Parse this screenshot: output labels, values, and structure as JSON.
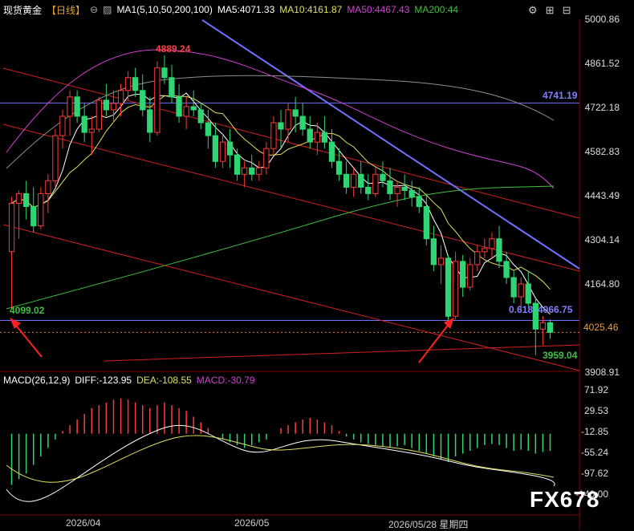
{
  "header": {
    "symbol": "现货黄金",
    "period": "【日线】",
    "ma_set": "MA1(5,10,50,200,100)",
    "ma5": "MA5:4071.33",
    "ma10": "MA10:4161.87",
    "ma50": "MA50:4467.43",
    "ma200": "MA200:44"
  },
  "macd_header": {
    "title": "MACD(26,12,9)",
    "diff": "DIFF:-123.95",
    "dea": "DEA:-108.55",
    "macd": "MACD:-30.79"
  },
  "price_axis": [
    "5000.86",
    "4861.52",
    "4722.18",
    "4582.83",
    "4443.49",
    "4304.14",
    "4164.80",
    "4025.46",
    "3908.91"
  ],
  "macd_axis": [
    "71.92",
    "29.53",
    "-12.85",
    "-55.24",
    "-97.62",
    "-140.00"
  ],
  "dates": [
    "2026/04",
    "2026/05",
    "2026/05/28 星期四"
  ],
  "annotations": {
    "high": "4889.24",
    "level1": "4741.19",
    "low1": "4099.02",
    "fib": "0.618",
    "fib_value": "4066.75",
    "low2": "3959.04"
  },
  "watermark": "FX678",
  "colors": {
    "up": "#ff3a3a",
    "down": "#2ed573",
    "ma5": "#ffffff",
    "ma10": "#e0e060",
    "ma50": "#d040d0",
    "ma200": "#40c040",
    "ma100": "#909090",
    "trend": "#7070ff",
    "channel": "#d02020"
  },
  "chart_data": {
    "type": "candlestick",
    "ohlc": [
      [
        4280,
        4450,
        4099,
        4430
      ],
      [
        4430,
        4470,
        4320,
        4460
      ],
      [
        4460,
        4500,
        4380,
        4420
      ],
      [
        4420,
        4480,
        4340,
        4360
      ],
      [
        4360,
        4480,
        4350,
        4460
      ],
      [
        4460,
        4520,
        4400,
        4500
      ],
      [
        4500,
        4660,
        4480,
        4640
      ],
      [
        4640,
        4720,
        4600,
        4700
      ],
      [
        4700,
        4780,
        4640,
        4760
      ],
      [
        4760,
        4780,
        4680,
        4700
      ],
      [
        4700,
        4740,
        4620,
        4650
      ],
      [
        4650,
        4700,
        4580,
        4660
      ],
      [
        4660,
        4760,
        4650,
        4750
      ],
      [
        4750,
        4800,
        4700,
        4720
      ],
      [
        4720,
        4780,
        4680,
        4740
      ],
      [
        4740,
        4800,
        4700,
        4780
      ],
      [
        4780,
        4840,
        4750,
        4820
      ],
      [
        4820,
        4850,
        4760,
        4780
      ],
      [
        4780,
        4830,
        4700,
        4720
      ],
      [
        4720,
        4760,
        4620,
        4650
      ],
      [
        4650,
        4870,
        4640,
        4850
      ],
      [
        4850,
        4889,
        4800,
        4820
      ],
      [
        4820,
        4860,
        4740,
        4760
      ],
      [
        4760,
        4800,
        4680,
        4700
      ],
      [
        4700,
        4760,
        4660,
        4730
      ],
      [
        4730,
        4780,
        4700,
        4720
      ],
      [
        4720,
        4740,
        4660,
        4680
      ],
      [
        4680,
        4720,
        4600,
        4640
      ],
      [
        4640,
        4680,
        4540,
        4560
      ],
      [
        4560,
        4640,
        4540,
        4620
      ],
      [
        4620,
        4660,
        4540,
        4580
      ],
      [
        4580,
        4600,
        4500,
        4520
      ],
      [
        4520,
        4560,
        4480,
        4540
      ],
      [
        4540,
        4580,
        4500,
        4520
      ],
      [
        4520,
        4560,
        4500,
        4540
      ],
      [
        4540,
        4620,
        4520,
        4600
      ],
      [
        4600,
        4700,
        4580,
        4680
      ],
      [
        4680,
        4720,
        4600,
        4660
      ],
      [
        4660,
        4740,
        4620,
        4720
      ],
      [
        4720,
        4760,
        4650,
        4700
      ],
      [
        4700,
        4740,
        4640,
        4660
      ],
      [
        4660,
        4700,
        4600,
        4620
      ],
      [
        4620,
        4680,
        4580,
        4650
      ],
      [
        4650,
        4700,
        4600,
        4620
      ],
      [
        4620,
        4660,
        4540,
        4560
      ],
      [
        4560,
        4600,
        4500,
        4520
      ],
      [
        4520,
        4560,
        4460,
        4480
      ],
      [
        4480,
        4540,
        4450,
        4520
      ],
      [
        4520,
        4560,
        4460,
        4480
      ],
      [
        4480,
        4520,
        4440,
        4460
      ],
      [
        4460,
        4540,
        4450,
        4520
      ],
      [
        4520,
        4560,
        4480,
        4500
      ],
      [
        4500,
        4540,
        4440,
        4460
      ],
      [
        4460,
        4500,
        4420,
        4480
      ],
      [
        4480,
        4520,
        4440,
        4470
      ],
      [
        4470,
        4500,
        4420,
        4450
      ],
      [
        4450,
        4480,
        4400,
        4420
      ],
      [
        4420,
        4460,
        4300,
        4320
      ],
      [
        4320,
        4360,
        4220,
        4240
      ],
      [
        4240,
        4300,
        4180,
        4260
      ],
      [
        4260,
        4270,
        4060,
        4080
      ],
      [
        4080,
        4280,
        4070,
        4250
      ],
      [
        4250,
        4270,
        4140,
        4170
      ],
      [
        4170,
        4260,
        4160,
        4240
      ],
      [
        4240,
        4300,
        4220,
        4280
      ],
      [
        4280,
        4320,
        4260,
        4290
      ],
      [
        4290,
        4340,
        4260,
        4320
      ],
      [
        4320,
        4360,
        4230,
        4250
      ],
      [
        4250,
        4280,
        4180,
        4200
      ],
      [
        4200,
        4220,
        4120,
        4140
      ],
      [
        4140,
        4200,
        4100,
        4180
      ],
      [
        4180,
        4220,
        4110,
        4120
      ],
      [
        4120,
        4140,
        3959,
        4040
      ],
      [
        4040,
        4080,
        3990,
        4060
      ],
      [
        4060,
        4070,
        4010,
        4030
      ]
    ],
    "macd_hist": [
      -90,
      -80,
      -70,
      -55,
      -40,
      -25,
      -10,
      5,
      15,
      25,
      35,
      45,
      50,
      55,
      60,
      62,
      60,
      55,
      50,
      45,
      50,
      55,
      50,
      45,
      40,
      30,
      20,
      10,
      0,
      -10,
      -15,
      -20,
      -25,
      -20,
      -15,
      -10,
      0,
      10,
      15,
      20,
      25,
      28,
      25,
      20,
      15,
      5,
      -5,
      -10,
      -15,
      -18,
      -20,
      -22,
      -25,
      -22,
      -20,
      -25,
      -30,
      -35,
      -40,
      -45,
      -50,
      -40,
      -35,
      -30,
      -25,
      -20,
      -18,
      -20,
      -25,
      -30,
      -28,
      -30,
      -35,
      -32,
      -30
    ],
    "x_labels": [
      "2026/04",
      "2026/05",
      "2026/05/28 星期四"
    ],
    "ylim": [
      3908.91,
      5000.86
    ]
  }
}
